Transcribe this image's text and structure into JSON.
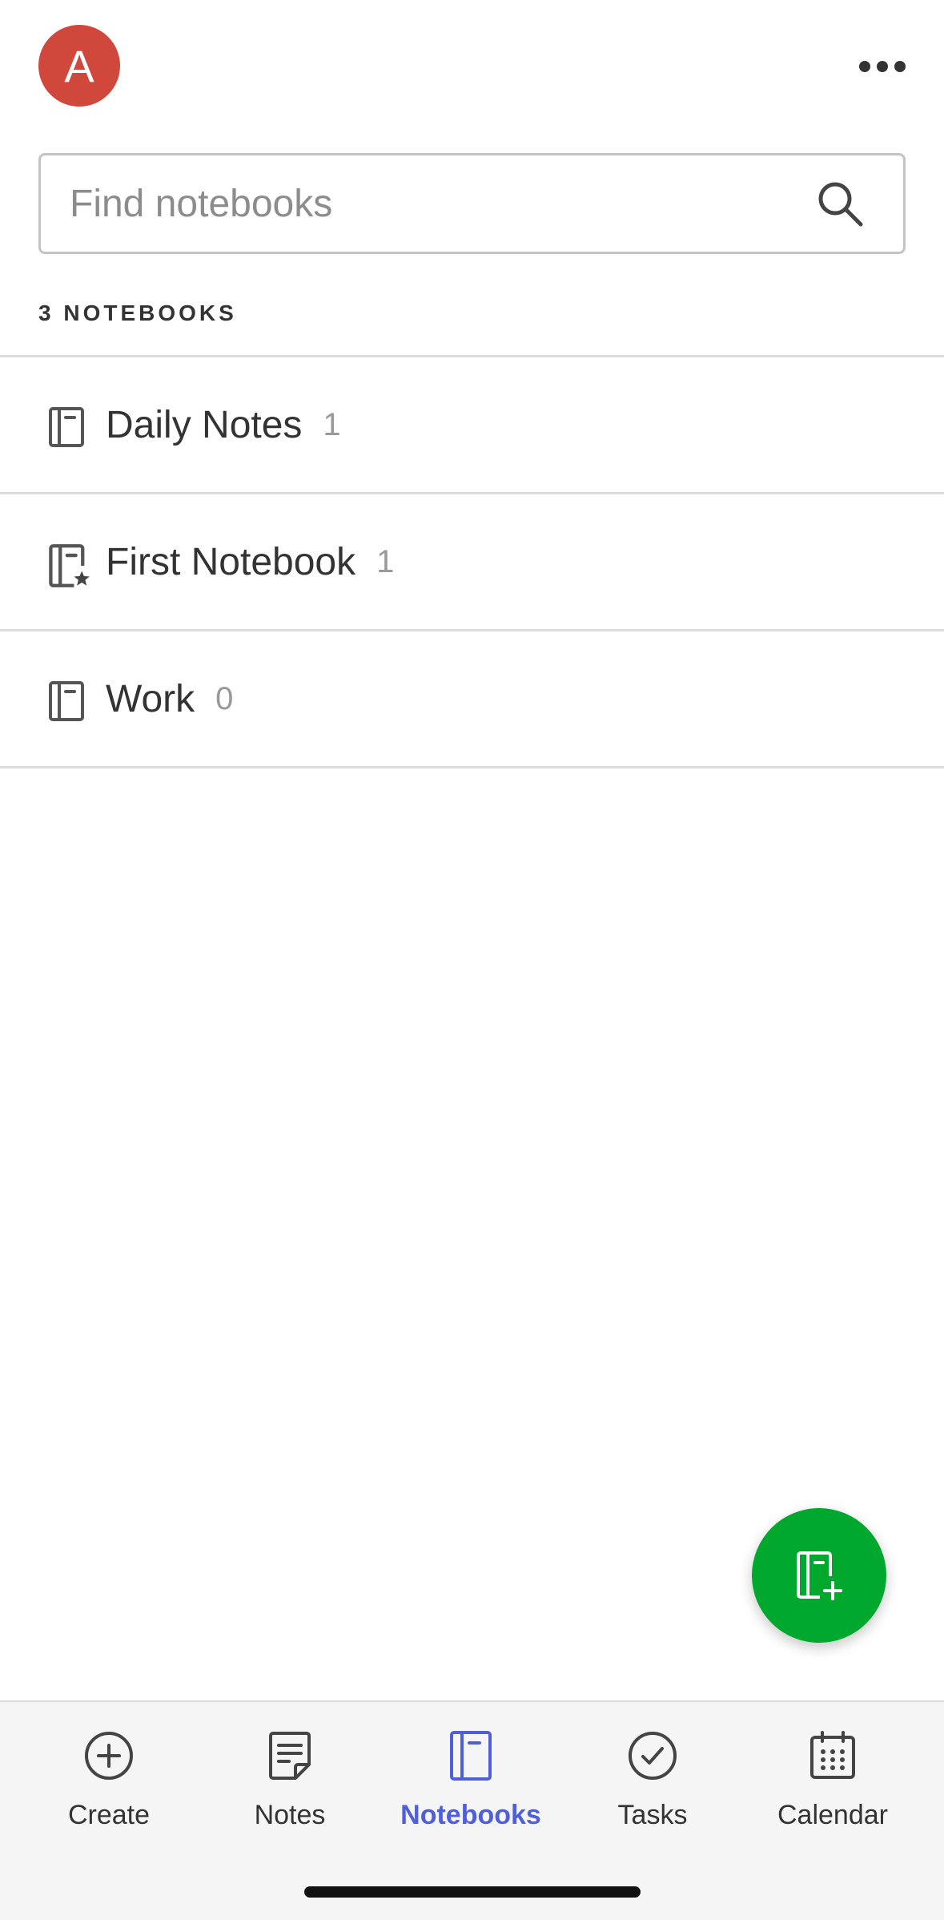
{
  "header": {
    "avatar_letter": "A",
    "avatar_color": "#d0483c",
    "more_icon": "more-horizontal-icon"
  },
  "search": {
    "placeholder": "Find notebooks",
    "value": "",
    "icon": "search-icon"
  },
  "list": {
    "heading": "3 NOTEBOOKS",
    "items": [
      {
        "name": "Daily Notes",
        "count": "1",
        "icon": "notebook-icon"
      },
      {
        "name": "First Notebook",
        "count": "1",
        "icon": "notebook-default-star-icon"
      },
      {
        "name": "Work",
        "count": "0",
        "icon": "notebook-icon"
      }
    ]
  },
  "fab": {
    "icon": "new-notebook-icon",
    "color": "#00a82d"
  },
  "bottom_nav": {
    "items": [
      {
        "label": "Create",
        "icon": "plus-circle-icon",
        "active": false
      },
      {
        "label": "Notes",
        "icon": "note-icon",
        "active": false
      },
      {
        "label": "Notebooks",
        "icon": "notebook-icon",
        "active": true
      },
      {
        "label": "Tasks",
        "icon": "check-circle-icon",
        "active": false
      },
      {
        "label": "Calendar",
        "icon": "calendar-icon",
        "active": false
      }
    ],
    "active_color": "#4f5fd8"
  }
}
